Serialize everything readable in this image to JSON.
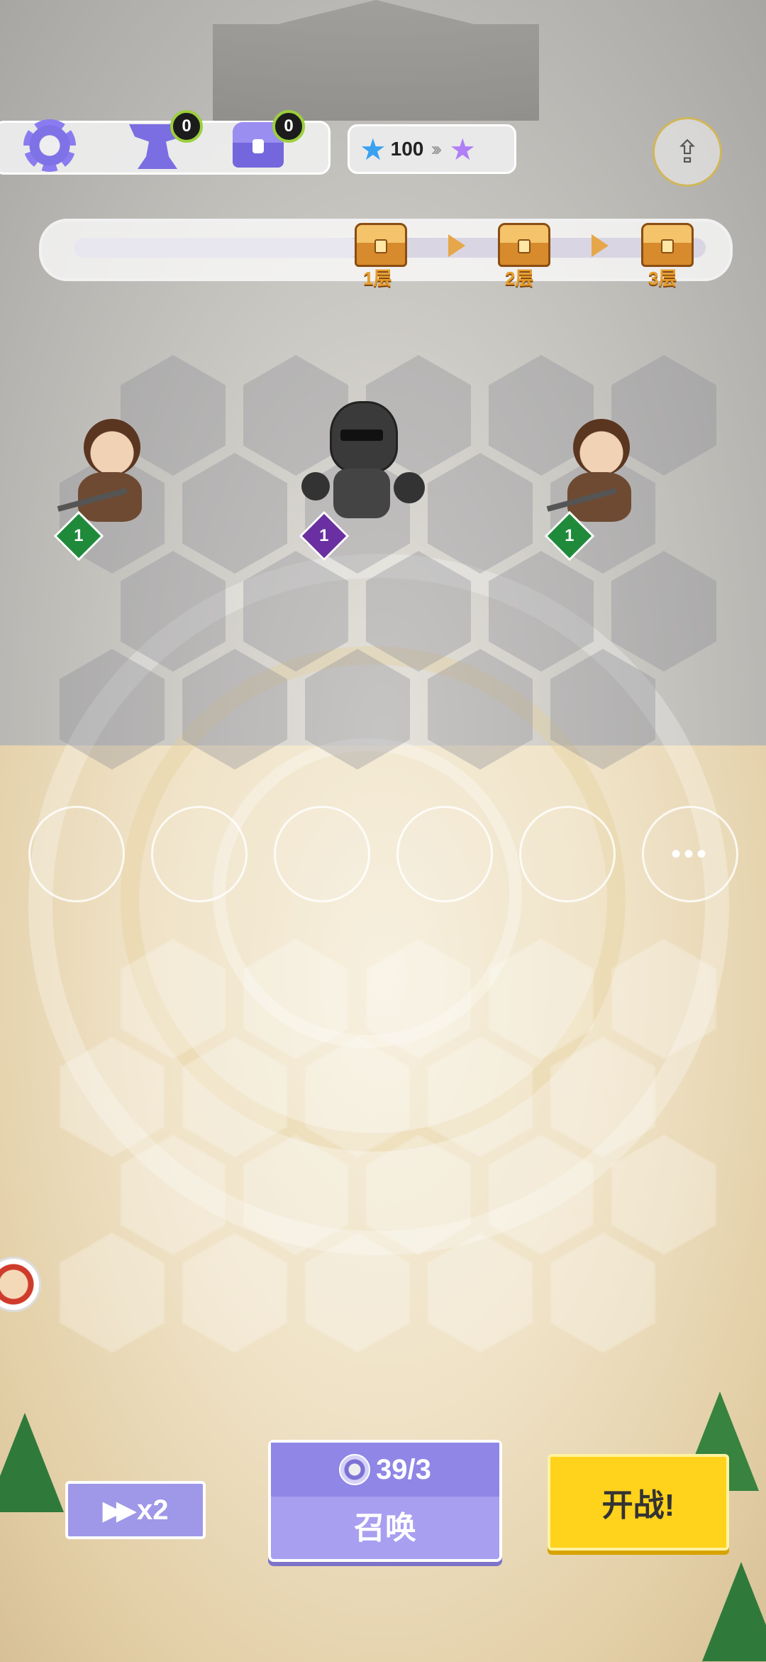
{
  "hud": {
    "anvil_count": "0",
    "chest_count": "0",
    "stars": "100"
  },
  "progress": {
    "stages": [
      "1层",
      "2层",
      "3层"
    ],
    "fill_fraction": 0.45
  },
  "units": [
    {
      "name": "archer-left",
      "level": "1",
      "level_color": "#1f8a3a"
    },
    {
      "name": "knight",
      "level": "1",
      "level_color": "#6a2fa0"
    },
    {
      "name": "archer-right",
      "level": "1",
      "level_color": "#1f8a3a"
    }
  ],
  "bench": {
    "more_label": "•••"
  },
  "controls": {
    "speed_label": "x2",
    "summon_cost": "39/3",
    "summon_label": "召唤",
    "start_label": "开战!"
  },
  "colors": {
    "accent_purple": "#a89ff0",
    "start_yellow": "#ffd21c",
    "level_green": "#1f8a3a",
    "level_purple": "#6a2fa0"
  }
}
